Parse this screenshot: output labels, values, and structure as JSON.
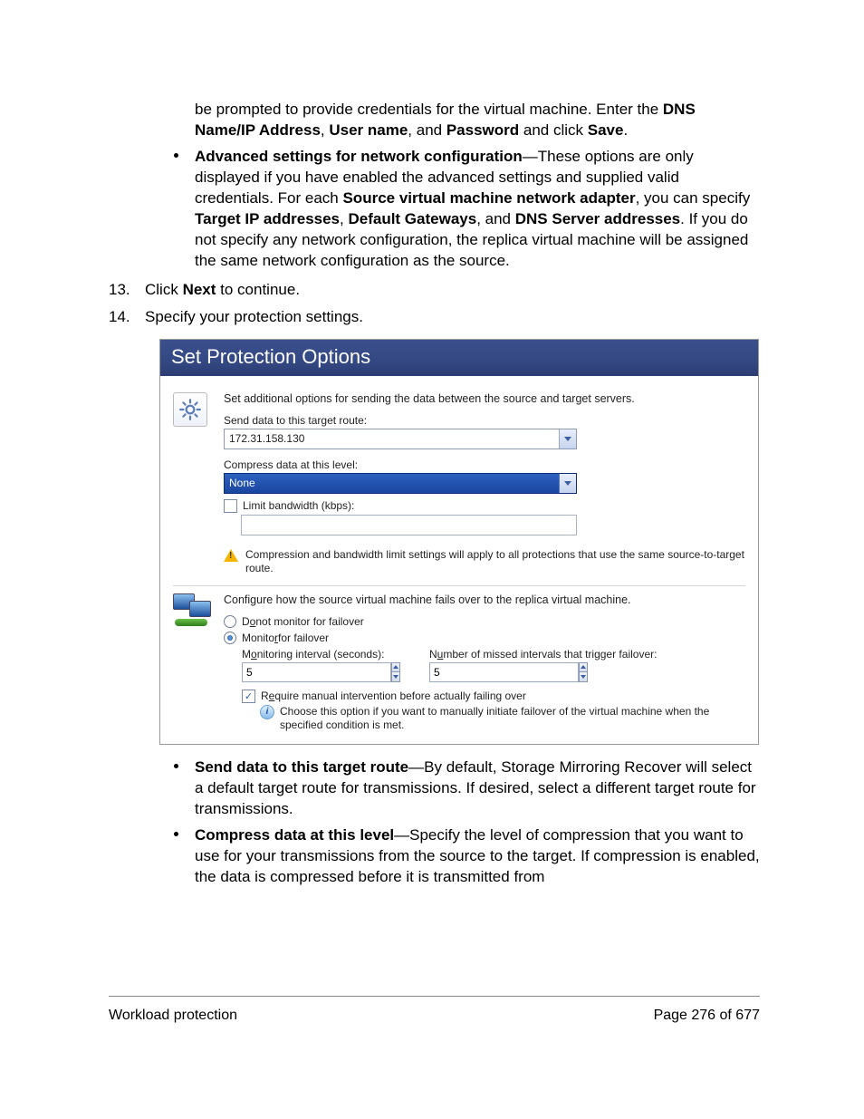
{
  "intro": {
    "line1a": "be prompted to provide credentials for the virtual machine. Enter the ",
    "dns": "DNS Name/IP Address",
    "line1b": ", ",
    "user": "User name",
    "line1c": ", and ",
    "pwd": "Password",
    "line1d": " and click ",
    "save": "Save",
    "line1e": "."
  },
  "bullet1": {
    "title": "Advanced settings for network configuration",
    "t1": "—These options are only displayed if you have enabled the advanced settings and supplied valid credentials. For each ",
    "b1": "Source virtual machine network adapter",
    "t2": ", you can specify ",
    "b2": "Target IP addresses",
    "t3": ", ",
    "b3": "Default Gateways",
    "t4": ", and ",
    "b4": "DNS Server addresses",
    "t5": ". If you do not specify any network configuration, the replica virtual machine will be assigned the same network configuration as the source."
  },
  "step13": {
    "num": "13.",
    "t1": "Click ",
    "b1": "Next",
    "t2": " to continue."
  },
  "step14": {
    "num": "14.",
    "t1": "Specify your protection settings."
  },
  "dialog": {
    "title": "Set Protection Options",
    "section1": {
      "desc": "Set additional options for sending the data between the source and target servers.",
      "routeLabel": "Send data to this target route:",
      "routeValue": "172.31.158.130",
      "compressLabel": "Compress data at this level:",
      "compressValue": "None",
      "limitLabel": "Limit bandwidth (kbps):",
      "limitValue": "",
      "warn": "Compression and bandwidth limit settings will apply to all protections that use the same source-to-target route."
    },
    "section2": {
      "desc": "Configure how the source virtual machine fails over to the replica virtual machine.",
      "radio1_pre": "D",
      "radio1_ul": "o",
      "radio1_post": " not monitor for failover",
      "radio2_pre": "Monito",
      "radio2_ul": "r",
      "radio2_post": " for failover",
      "intervalLabel_pre": "M",
      "intervalLabel_ul": "o",
      "intervalLabel_post": "nitoring interval (seconds):",
      "intervalValue": "5",
      "missedLabel_pre": "N",
      "missedLabel_ul": "u",
      "missedLabel_post": "mber of missed intervals that trigger failover:",
      "missedValue": "5",
      "manual_pre": "R",
      "manual_ul": "e",
      "manual_post": "quire manual intervention before actually failing over",
      "info": "Choose this option if you want to manually initiate failover of the virtual machine when the specified condition is met."
    }
  },
  "bullet2": {
    "title": "Send data to this target route",
    "text": "—By default, Storage Mirroring Recover will select a default target route for transmissions. If desired, select a different target route for transmissions."
  },
  "bullet3": {
    "title": "Compress data at this level",
    "text": "—Specify the level of compression that you want to use for your transmissions from the source to the target. If compression is enabled, the data is compressed before it is transmitted from"
  },
  "footer": {
    "left": "Workload protection",
    "right": "Page 276 of 677"
  }
}
